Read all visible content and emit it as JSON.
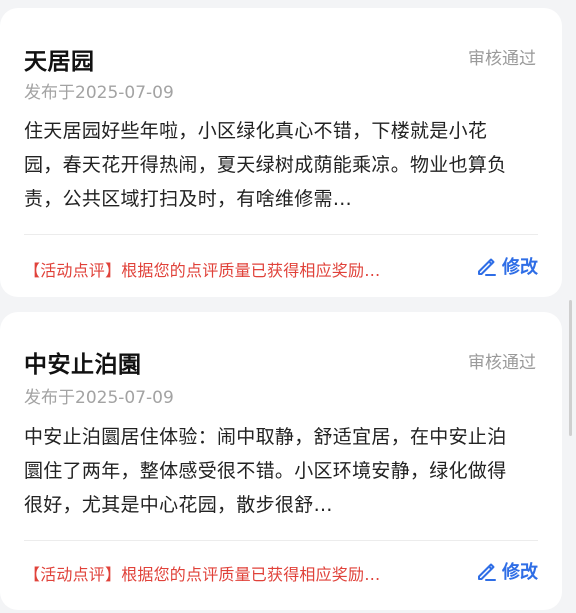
{
  "reviews": [
    {
      "title": "天居园",
      "status": "审核通过",
      "date": "发布于2025-07-09",
      "content": "住天居园好些年啦，小区绿化真心不错，下楼就是小花园，春天花开得热闹，夏天绿树成荫能乘凉。物业也算负责，公共区域打扫及时，有啥维修需…",
      "note": "【活动点评】根据您的点评质量已获得相应奖励…",
      "edit_label": "修改"
    },
    {
      "title": "中安止泊園",
      "status": "审核通过",
      "date": "发布于2025-07-09",
      "content": "中安止泊圜居住体验：闹中取静，舒适宜居，在中安止泊圜住了两年，整体感受很不错。小区环境安静，绿化做得很好，尤其是中心花园，散步很舒…",
      "note": "【活动点评】根据您的点评质量已获得相应奖励…",
      "edit_label": "修改"
    }
  ],
  "colors": {
    "background": "#f3f4f6",
    "card": "#ffffff",
    "status": "#9a9a9a",
    "note": "#e0423a",
    "accent": "#2f6ee6"
  },
  "icons": {
    "edit": "pencil-icon"
  }
}
